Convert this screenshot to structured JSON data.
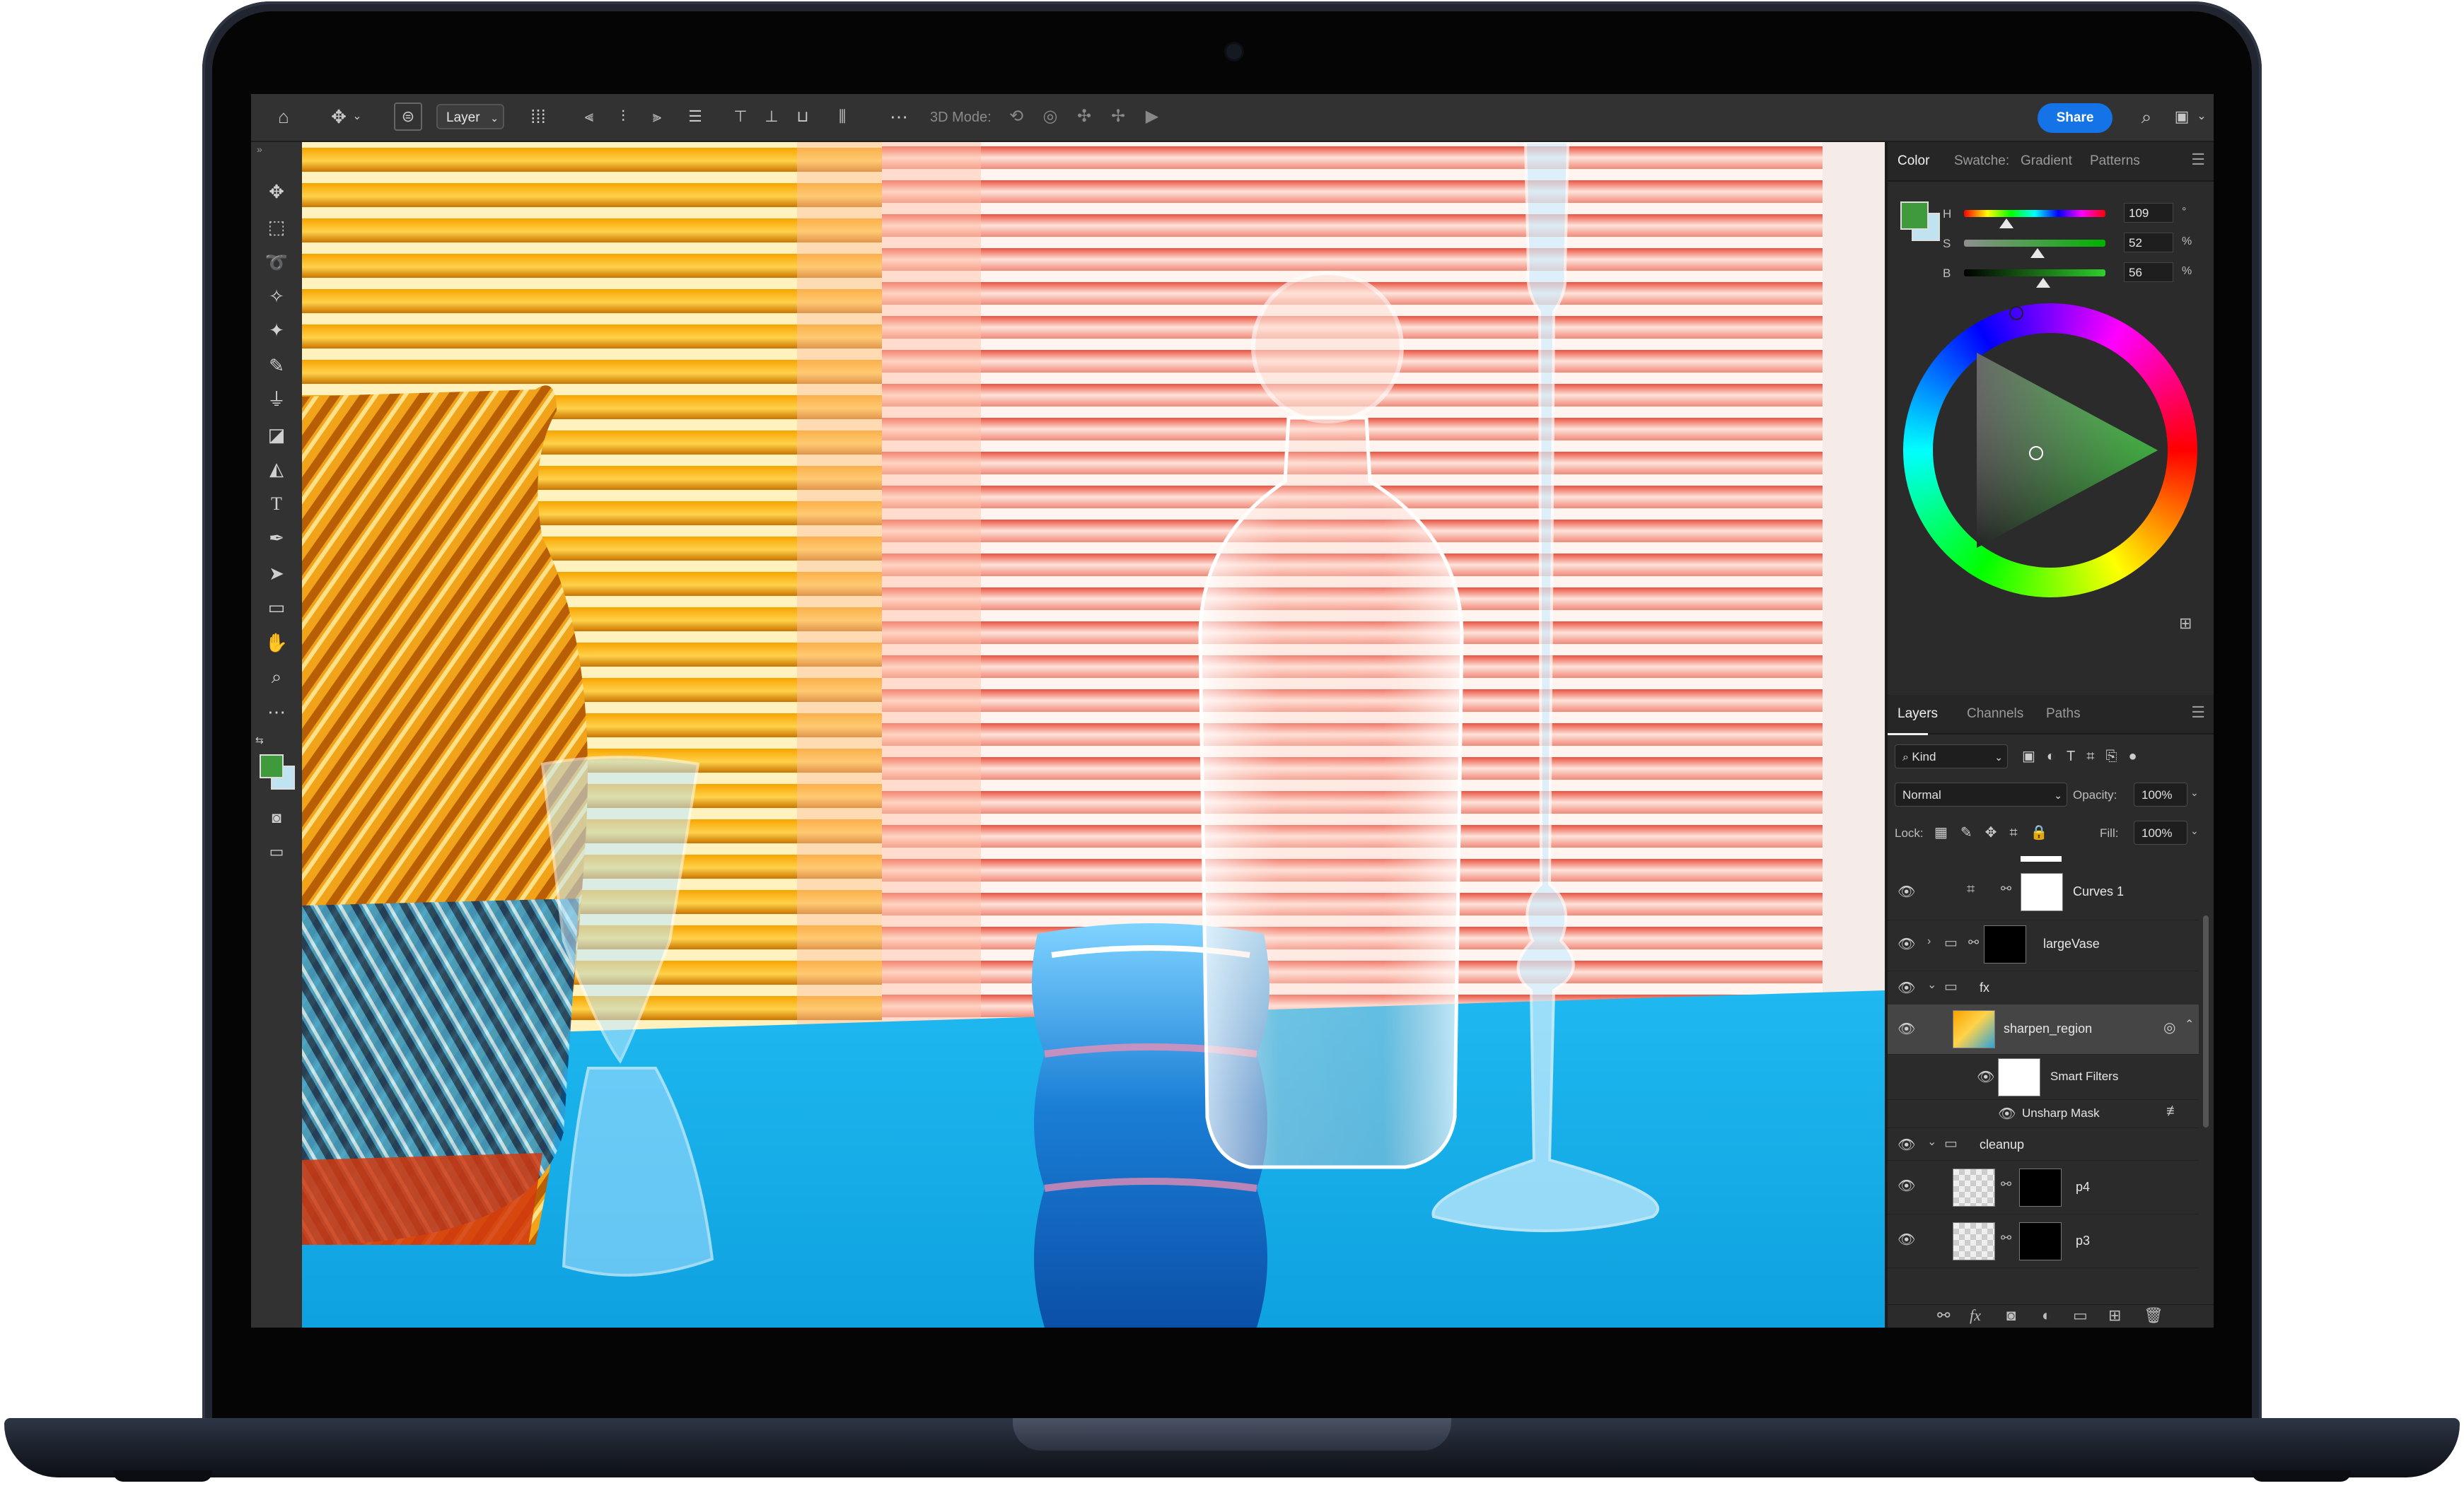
{
  "options_bar": {
    "layer_select": "Layer",
    "mode_label": "3D Mode:",
    "share_label": "Share",
    "icons": [
      "home-icon",
      "move-icon",
      "auto-select-icon",
      "transform-icon",
      "align-left-icon",
      "align-center-icon",
      "align-right-icon",
      "distribute-icon",
      "align-top-icon",
      "align-middle-icon",
      "align-bottom-icon",
      "distribute-vertical-icon",
      "more-icon",
      "orbit-3d-icon",
      "roll-3d-icon",
      "drag-3d-icon",
      "slide-3d-icon",
      "scale-3d-icon",
      "search-icon",
      "workspace-icon"
    ]
  },
  "tools": [
    "move-tool",
    "marquee-tool",
    "lasso-tool",
    "object-select-tool",
    "healing-tool",
    "brush-tool",
    "clone-stamp-tool",
    "eraser-tool",
    "paint-bucket-tool",
    "type-tool",
    "pen-tool",
    "path-select-tool",
    "rectangle-tool",
    "hand-tool",
    "zoom-tool",
    "more-tools"
  ],
  "swatch_colors": {
    "foreground": "#3f9a3c",
    "background": "#bfe3f0"
  },
  "color_panel": {
    "tabs": [
      "Color",
      "Swatche:",
      "Gradient",
      "Patterns"
    ],
    "active_tab": "Color",
    "sliders": [
      {
        "label": "H",
        "value": "109",
        "unit": "°",
        "fraction": 0.3
      },
      {
        "label": "S",
        "value": "52",
        "unit": "%",
        "fraction": 0.52
      },
      {
        "label": "B",
        "value": "56",
        "unit": "%",
        "fraction": 0.56
      }
    ],
    "current_color": "#3f9a3c"
  },
  "layers_panel": {
    "tabs": [
      "Layers",
      "Channels",
      "Paths"
    ],
    "active_tab": "Layers",
    "filter_label": "Kind",
    "blend_mode": "Normal",
    "opacity_label": "Opacity:",
    "opacity_value": "100%",
    "lock_label": "Lock:",
    "fill_label": "Fill:",
    "fill_value": "100%",
    "layers": [
      {
        "name": "Curves 1",
        "kind": "adjustment",
        "selected": false
      },
      {
        "name": "largeVase",
        "kind": "group",
        "selected": false
      },
      {
        "name": "fx",
        "kind": "group-open",
        "selected": false
      },
      {
        "name": "sharpen_region",
        "kind": "smart-object",
        "selected": true
      },
      {
        "name": "Smart Filters",
        "kind": "filter-mask",
        "selected": false
      },
      {
        "name": "Unsharp Mask",
        "kind": "filter",
        "selected": false
      },
      {
        "name": "cleanup",
        "kind": "group-open",
        "selected": false
      },
      {
        "name": "p4",
        "kind": "pixel-masked",
        "selected": false
      },
      {
        "name": "p3",
        "kind": "pixel-masked",
        "selected": false
      }
    ]
  }
}
